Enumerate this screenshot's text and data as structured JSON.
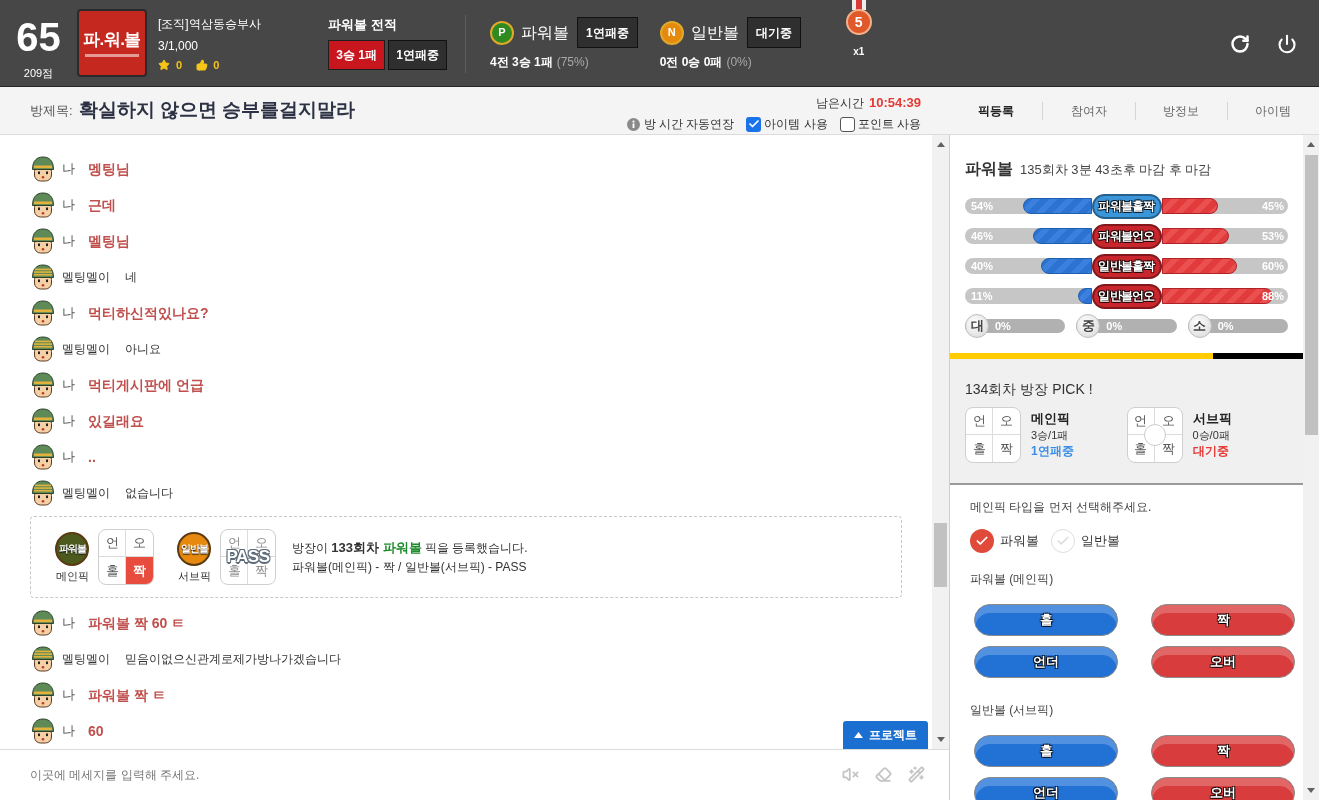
{
  "header": {
    "level_number": "65",
    "points": "209점",
    "logo": {
      "title": "파.워.볼"
    },
    "user": {
      "name": "[조직]역삼동승부사",
      "ratio": "3/1,000",
      "stars": "0",
      "likes": "0"
    },
    "record": {
      "title": "파워볼 전적",
      "result": "3승 1패",
      "streak": "1연패중"
    },
    "games": [
      {
        "badge": "P",
        "color": "#2f8a1f",
        "name": "파워볼",
        "status": "1연패중",
        "record": "4전 3승 1패",
        "rate": "(75%)"
      },
      {
        "badge": "N",
        "color": "#e58a0c",
        "name": "일반볼",
        "status": "대기중",
        "record": "0전 0승 0패",
        "rate": "(0%)"
      }
    ],
    "medal": {
      "number": "5",
      "count": "x1"
    }
  },
  "room": {
    "label": "방제목:",
    "title": "확실하지 않으면 승부를걸지말라",
    "timer_label": "남은시간",
    "timer": "10:54:39",
    "auto_extend": "방 시간 자동연장",
    "options": [
      {
        "label": "아이템 사용",
        "checked": true
      },
      {
        "label": "포인트 사용",
        "checked": false
      }
    ]
  },
  "tabs": [
    {
      "label": "픽등록",
      "selected": true
    },
    {
      "label": "참여자",
      "selected": false
    },
    {
      "label": "방정보",
      "selected": false
    },
    {
      "label": "아이템",
      "selected": false
    }
  ],
  "chat": {
    "items": [
      {
        "kind": "self",
        "name": "나",
        "text": "멩팅님"
      },
      {
        "kind": "self",
        "name": "나",
        "text": "근데"
      },
      {
        "kind": "self",
        "name": "나",
        "text": "멜팅님"
      },
      {
        "kind": "other",
        "name": "멜팅멜이",
        "text": "네"
      },
      {
        "kind": "self",
        "name": "나",
        "text": "먹티하신적있나요?"
      },
      {
        "kind": "other",
        "name": "멜팅멜이",
        "text": "아니요"
      },
      {
        "kind": "self",
        "name": "나",
        "text": "먹티게시판에 언급"
      },
      {
        "kind": "self",
        "name": "나",
        "text": "있길래요"
      },
      {
        "kind": "self",
        "name": "나",
        "text": ".."
      },
      {
        "kind": "other",
        "name": "멜팅멜이",
        "text": "없습니다"
      },
      {
        "kind": "notice",
        "picks": [
          {
            "badge": "파워볼",
            "color": "#4d5a1e",
            "label": "메인픽",
            "cells": [
              {
                "label": "언",
                "selected": false
              },
              {
                "label": "오",
                "selected": false
              },
              {
                "label": "홀",
                "selected": false
              },
              {
                "label": "짝",
                "selected": true
              }
            ]
          },
          {
            "badge": "일반볼",
            "color": "#e8890f",
            "label": "서브픽",
            "overlay": "PASS",
            "cells": [
              {
                "label": "언",
                "selected": false
              },
              {
                "label": "오",
                "selected": false
              },
              {
                "label": "홀",
                "selected": false
              },
              {
                "label": "짝",
                "selected": false
              }
            ]
          }
        ],
        "message": {
          "before": "방장이 ",
          "round": "133회차 ",
          "game": "파워볼",
          "after": " 픽을 등록했습니다."
        },
        "detail": "파워볼(메인픽) - 짝 / 일반볼(서브픽) - PASS"
      },
      {
        "kind": "self",
        "name": "나",
        "text": "파워볼 짝 60 ㅌ"
      },
      {
        "kind": "other",
        "name": "멜팅멜이",
        "text": "믿음이없으신관계로제가방나가겠습니다"
      },
      {
        "kind": "self",
        "name": "나",
        "text": "파워볼 짝 ㅌ"
      },
      {
        "kind": "self",
        "name": "나",
        "text": "60"
      }
    ],
    "project_button": "프로젝트",
    "input": {
      "placeholder": "이곳에 메세지를 입력해 주세요."
    }
  },
  "panel": {
    "game": "파워볼",
    "round_info": "135회차 3분 43초후 마감 후 마감",
    "bars": [
      {
        "label": "파워볼홀짝",
        "color": "#3b95d9",
        "sides": [
          {
            "reading": "54%",
            "level": 0.54
          },
          {
            "reading": "45%",
            "level": 0.45
          }
        ]
      },
      {
        "label": "파워볼언오",
        "color": "#c8262c",
        "sides": [
          {
            "reading": "46%",
            "level": 0.46
          },
          {
            "reading": "53%",
            "level": 0.53
          }
        ]
      },
      {
        "label": "일반볼홀짝",
        "color": "#c8262c",
        "sides": [
          {
            "reading": "40%",
            "level": 0.4
          },
          {
            "reading": "60%",
            "level": 0.6
          }
        ]
      },
      {
        "label": "일반볼언오",
        "color": "#c8262c",
        "sides": [
          {
            "reading": "11%",
            "level": 0.11
          },
          {
            "reading": "88%",
            "level": 0.88
          }
        ]
      }
    ],
    "sizes": [
      {
        "label": "대",
        "reading": "0%",
        "level": 0
      },
      {
        "label": "중",
        "reading": "0%",
        "level": 0
      },
      {
        "label": "소",
        "reading": "0%",
        "level": 0
      }
    ],
    "timer_bar": {
      "level": 0.745
    },
    "last_pick": {
      "title": "134회차 방장 PICK !",
      "cards": [
        {
          "cells": [
            "언",
            "오",
            "홀",
            "짝"
          ],
          "pending": false,
          "name": "메인픽",
          "record": "3승/1패",
          "status": "1연패중",
          "color": "#3a8ee6"
        },
        {
          "cells": [
            "언",
            "오",
            "홀",
            "짝"
          ],
          "pending": true,
          "name": "서브픽",
          "record": "0승/0패",
          "status": "대기중",
          "color": "#e53935"
        }
      ]
    },
    "form": {
      "hint": "메인픽 타입을 먼저 선택해주세요.",
      "types": [
        {
          "label": "파워볼",
          "selected": true
        },
        {
          "label": "일반볼",
          "selected": false
        }
      ],
      "groups": [
        {
          "title": "파워볼 (메인픽)",
          "buttons": [
            {
              "label": "홀",
              "color": "#2272d6"
            },
            {
              "label": "짝",
              "color": "#d93c3c"
            },
            {
              "label": "언더",
              "color": "#2272d6"
            },
            {
              "label": "오버",
              "color": "#d93c3c"
            }
          ]
        },
        {
          "title": "일반볼 (서브픽)",
          "buttons": [
            {
              "label": "홀",
              "color": "#2272d6"
            },
            {
              "label": "짝",
              "color": "#d93c3c"
            },
            {
              "label": "언더",
              "color": "#2272d6"
            },
            {
              "label": "오버",
              "color": "#d93c3c"
            }
          ]
        }
      ]
    }
  }
}
